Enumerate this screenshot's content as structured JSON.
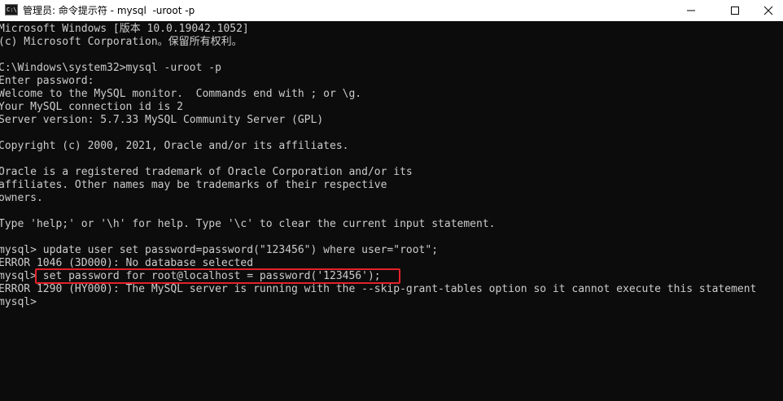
{
  "window": {
    "title": "管理员: 命令提示符 - mysql  -uroot -p",
    "icon_name": "cmd-icon",
    "controls": {
      "minimize": "minimize-icon",
      "maximize": "maximize-icon",
      "close": "close-icon"
    }
  },
  "console": {
    "lines": [
      "Microsoft Windows [版本 10.0.19042.1052]",
      "(c) Microsoft Corporation。保留所有权利。",
      "",
      "C:\\Windows\\system32>mysql -uroot -p",
      "Enter password:",
      "Welcome to the MySQL monitor.  Commands end with ; or \\g.",
      "Your MySQL connection id is 2",
      "Server version: 5.7.33 MySQL Community Server (GPL)",
      "",
      "Copyright (c) 2000, 2021, Oracle and/or its affiliates.",
      "",
      "Oracle is a registered trademark of Oracle Corporation and/or its",
      "affiliates. Other names may be trademarks of their respective",
      "owners.",
      "",
      "Type 'help;' or '\\h' for help. Type '\\c' to clear the current input statement.",
      "",
      "mysql> update user set password=password(\"123456\") where user=\"root\";",
      "ERROR 1046 (3D000): No database selected",
      "mysql> set password for root@localhost = password('123456');",
      "ERROR 1290 (HY000): The MySQL server is running with the --skip-grant-tables option so it cannot execute this statement",
      "mysql>"
    ]
  },
  "colors": {
    "background": "#0c0c0c",
    "text": "#cccccc",
    "highlight": "#e3222a",
    "titlebar": "#ffffff"
  }
}
